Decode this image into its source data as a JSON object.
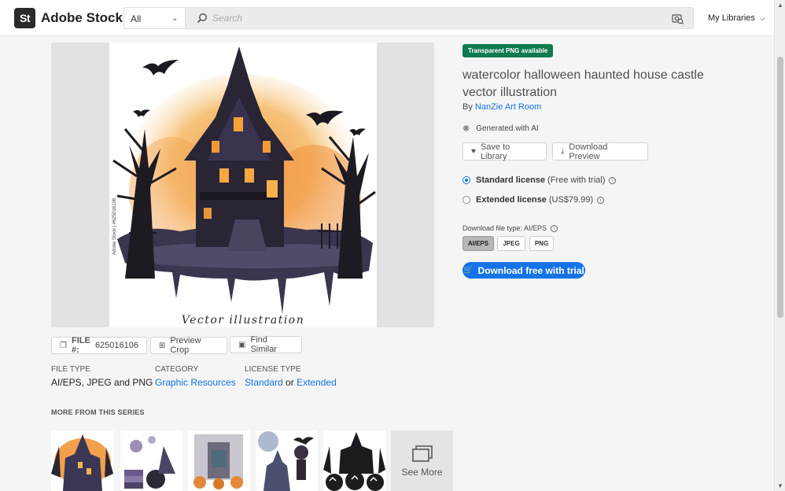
{
  "header": {
    "logo_mark": "St",
    "logo_text": "Adobe Stock",
    "category_selected": "All",
    "search_placeholder": "Search",
    "my_libraries": "My Libraries"
  },
  "preview": {
    "watermark": "Adobe Stock | #625016106",
    "caption": "Vector illustration"
  },
  "actions": {
    "file_label": "FILE #:",
    "file_number": "625016106",
    "preview_crop": "Preview Crop",
    "find_similar": "Find Similar"
  },
  "meta": {
    "file_type_label": "FILE TYPE",
    "file_type_value": "AI/EPS, JPEG and PNG",
    "category_label": "CATEGORY",
    "category_value": "Graphic Resources",
    "license_type_label": "LICENSE TYPE",
    "license_standard": "Standard",
    "license_or": "or",
    "license_extended": "Extended"
  },
  "series": {
    "label": "MORE FROM THIS SERIES",
    "see_more": "See More"
  },
  "asset": {
    "badge": "Transparent PNG available",
    "title": "watercolor halloween haunted house castle vector illustration",
    "by": "By",
    "author": "NanZie Art Room",
    "ai_note": "Generated with AI",
    "save_to_library": "Save to Library",
    "download_preview": "Download Preview"
  },
  "licenses": [
    {
      "name": "Standard license",
      "detail": "(Free with trial)",
      "selected": true
    },
    {
      "name": "Extended license",
      "detail": "(US$79.99)",
      "selected": false
    }
  ],
  "download": {
    "file_type_label": "Download file type: AI/EPS",
    "types": [
      "AI/EPS",
      "JPEG",
      "PNG"
    ],
    "selected_type": "AI/EPS",
    "cta": "Download free with trial"
  },
  "colors": {
    "accent": "#1473e6",
    "badge": "#0f7b4f"
  }
}
